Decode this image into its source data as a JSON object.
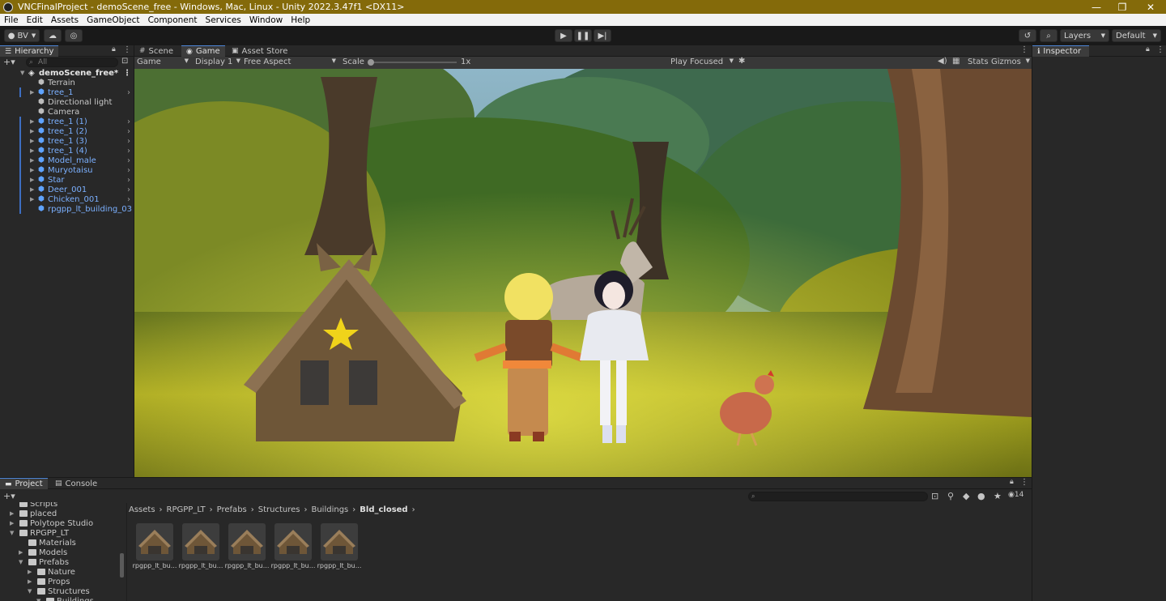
{
  "window": {
    "title": "VNCFinalProject - demoScene_free - Windows, Mac, Linux - Unity 2022.3.47f1 <DX11>",
    "controls": {
      "minimize": "—",
      "maximize": "❐",
      "close": "✕"
    }
  },
  "menu": [
    "File",
    "Edit",
    "Assets",
    "GameObject",
    "Component",
    "Services",
    "Window",
    "Help"
  ],
  "toolbar": {
    "account": "BV",
    "layers": "Layers",
    "layout": "Default"
  },
  "hierarchy": {
    "tab": "Hierarchy",
    "search_placeholder": "All",
    "scene": "demoScene_free*",
    "items": [
      {
        "label": "Terrain",
        "kind": "plain",
        "expandable": false
      },
      {
        "label": "tree_1",
        "kind": "prefab",
        "expandable": true
      },
      {
        "label": "Directional light",
        "kind": "plain",
        "expandable": false
      },
      {
        "label": "Camera",
        "kind": "plain",
        "expandable": false
      },
      {
        "label": "tree_1 (1)",
        "kind": "prefab",
        "expandable": true
      },
      {
        "label": "tree_1 (2)",
        "kind": "prefab",
        "expandable": true
      },
      {
        "label": "tree_1 (3)",
        "kind": "prefab",
        "expandable": true
      },
      {
        "label": "tree_1 (4)",
        "kind": "prefab",
        "expandable": true
      },
      {
        "label": "Model_male",
        "kind": "prefab",
        "expandable": true
      },
      {
        "label": "Muryotaisu",
        "kind": "prefab",
        "expandable": true
      },
      {
        "label": "Star",
        "kind": "prefab",
        "expandable": true
      },
      {
        "label": "Deer_001",
        "kind": "prefab",
        "expandable": true
      },
      {
        "label": "Chicken_001",
        "kind": "prefab",
        "expandable": true
      },
      {
        "label": "rpgpp_lt_building_03",
        "kind": "prefab",
        "expandable": false
      }
    ]
  },
  "center_tabs": [
    "Scene",
    "Game",
    "Asset Store"
  ],
  "game_bar": {
    "mode": "Game",
    "display": "Display 1",
    "aspect": "Free Aspect",
    "scale_label": "Scale",
    "scale_value": 0.0,
    "scale_text": "1x",
    "play_mode": "Play Focused",
    "stats": "Stats",
    "gizmos": "Gizmos"
  },
  "inspector": {
    "tab": "Inspector"
  },
  "project": {
    "tabs": [
      "Project",
      "Console"
    ],
    "eye_count": "14",
    "tree": [
      {
        "label": "Scripts",
        "depth": 1,
        "arrow": ""
      },
      {
        "label": "placed",
        "depth": 1,
        "arrow": "▶"
      },
      {
        "label": "Polytope Studio",
        "depth": 1,
        "arrow": "▶"
      },
      {
        "label": "RPGPP_LT",
        "depth": 1,
        "arrow": "▼"
      },
      {
        "label": "Materials",
        "depth": 2,
        "arrow": ""
      },
      {
        "label": "Models",
        "depth": 2,
        "arrow": "▶"
      },
      {
        "label": "Prefabs",
        "depth": 2,
        "arrow": "▼"
      },
      {
        "label": "Nature",
        "depth": 3,
        "arrow": "▶"
      },
      {
        "label": "Props",
        "depth": 3,
        "arrow": "▶"
      },
      {
        "label": "Structures",
        "depth": 3,
        "arrow": "▼"
      },
      {
        "label": "Buildings",
        "depth": 4,
        "arrow": "▼"
      }
    ],
    "breadcrumb": [
      "Assets",
      "RPGPP_LT",
      "Prefabs",
      "Structures",
      "Buildings",
      "Bld_closed"
    ],
    "assets": [
      "rpgpp_lt_bu...",
      "rpgpp_lt_bu...",
      "rpgpp_lt_bu...",
      "rpgpp_lt_bu...",
      "rpgpp_lt_bu..."
    ]
  }
}
